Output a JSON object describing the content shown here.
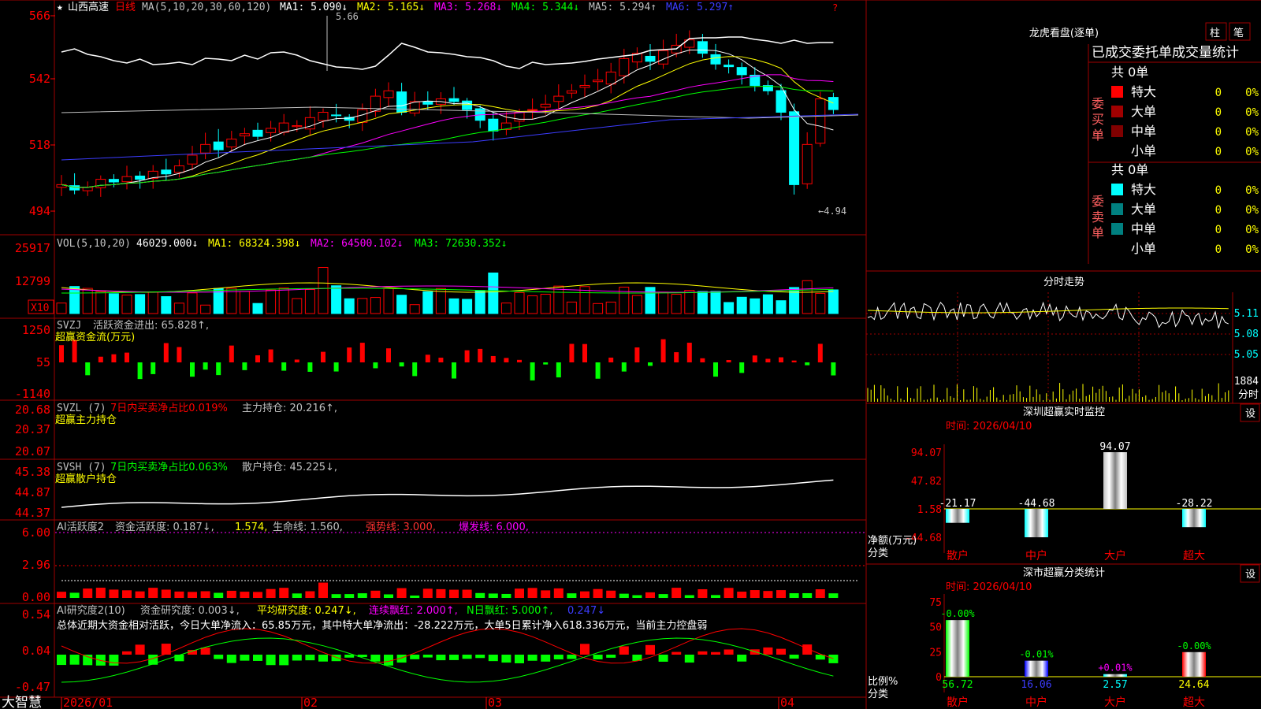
{
  "stock": {
    "star": "★",
    "name": "山西高速",
    "period": "日线"
  },
  "price_panel": {
    "ma_label": "MA(5,10,20,30,60,120)",
    "ma": [
      {
        "text": "MA1: 5.090↓",
        "color": "#ffffff"
      },
      {
        "text": "MA2: 5.165↓",
        "color": "#ffff00"
      },
      {
        "text": "MA3: 5.268↓",
        "color": "#ff00ff"
      },
      {
        "text": "MA4: 5.344↓",
        "color": "#00ff00"
      },
      {
        "text": "MA5: 5.294↑",
        "color": "#c0c0c0"
      },
      {
        "text": "MA6: 5.297↑",
        "color": "#3c3cff"
      }
    ],
    "y_ticks": [
      "566",
      "542",
      "518",
      "494"
    ],
    "high_mark": "5.66",
    "low_mark": "←4.94",
    "corner_mark": "?"
  },
  "vol_panel": {
    "label": "VOL(5,10,20)",
    "value": "46029.000↓",
    "ma": [
      {
        "text": "MA1: 68324.398↓",
        "color": "#ffff00"
      },
      {
        "text": "MA2: 64500.102↓",
        "color": "#ff00ff"
      },
      {
        "text": "MA3: 72630.352↓",
        "color": "#00ff00"
      }
    ],
    "y_ticks": [
      "25917",
      "12799"
    ],
    "unit": "X10"
  },
  "svzj_panel": {
    "label": "SVZJ",
    "text": "活跃资金进出: 65.828↑,",
    "sub": "超赢资金流(万元)",
    "y_ticks": [
      "1250",
      "55",
      "-1140"
    ]
  },
  "svzl_panel": {
    "label": "SVZL (7)",
    "text1": "7日内买卖净占比0.019%",
    "text2": "主力持仓: 20.216↑,",
    "sub": "超赢主力持仓",
    "y_ticks": [
      "20.68",
      "20.37",
      "20.07"
    ]
  },
  "svsh_panel": {
    "label": "SVSH (7)",
    "text1": "7日内买卖净占比0.063%",
    "text2": "散户持仓: 45.225↓,",
    "sub": "超赢散户持仓",
    "y_ticks": [
      "45.38",
      "44.87",
      "44.37"
    ]
  },
  "ai_activity_panel": {
    "label": "AI活跃度2",
    "items": [
      {
        "text": "资金活跃度: 0.187↓,",
        "color": "#c0c0c0"
      },
      {
        "text": "1.574,",
        "color": "#ffff00"
      },
      {
        "text": "生命线: 1.560,",
        "color": "#c0c0c0"
      },
      {
        "text": "强势线: 3.000,",
        "color": "#ff3030"
      },
      {
        "text": "爆发线: 6.000,",
        "color": "#ff00ff"
      }
    ],
    "y_ticks": [
      "6.00",
      "2.96",
      "0.00"
    ]
  },
  "ai_research_panel": {
    "label": "AI研究度2(10)",
    "items": [
      {
        "text": "资金研究度: 0.003↓,",
        "color": "#c0c0c0"
      },
      {
        "text": "平均研究度: 0.247↓,",
        "color": "#ffff00"
      },
      {
        "text": "连续飘红: 2.000↑,",
        "color": "#ff00ff"
      },
      {
        "text": "N日飘红: 5.000↑,",
        "color": "#00ff00"
      },
      {
        "text": "0.247↓",
        "color": "#3c3cff"
      }
    ],
    "summary": "总体近期大资金相对活跃，今日大单净流入：65.85万元，其中特大单净流出：-28.222万元，大单5日累计净入618.336万元，当前主力控盘弱",
    "y_ticks": [
      "0.54",
      "0.04",
      "-0.47"
    ]
  },
  "x_axis": {
    "brand": "大智慧",
    "dates": [
      "2026/01",
      "02",
      "03",
      "04"
    ]
  },
  "dragon_tiger": {
    "title": "龙虎看盘(逐单)",
    "btn_col": "柱",
    "btn_order": "笔",
    "header": "已成交委托单成交量统计",
    "buy": {
      "side_label": [
        "委",
        "买",
        "单"
      ],
      "total": "共 0单",
      "rows": [
        {
          "label": "特大",
          "color": "#ff0000",
          "count": "0",
          "pct": "0%"
        },
        {
          "label": "大单",
          "color": "#a00000",
          "count": "0",
          "pct": "0%"
        },
        {
          "label": "中单",
          "color": "#800000",
          "count": "0",
          "pct": "0%"
        },
        {
          "label": "小单",
          "color": "",
          "count": "0",
          "pct": "0%"
        }
      ]
    },
    "sell": {
      "side_label": [
        "委",
        "卖",
        "单"
      ],
      "total": "共 0单",
      "rows": [
        {
          "label": "特大",
          "color": "#00ffff",
          "count": "0",
          "pct": "0%"
        },
        {
          "label": "大单",
          "color": "#008080",
          "count": "0",
          "pct": "0%"
        },
        {
          "label": "中单",
          "color": "#008080",
          "count": "0",
          "pct": "0%"
        },
        {
          "label": "小单",
          "color": "",
          "count": "0",
          "pct": "0%"
        }
      ]
    }
  },
  "intraday": {
    "title": "分时走势",
    "price_ticks": [
      "5.11",
      "5.08",
      "5.05"
    ],
    "vol_tick": "1884",
    "vol_label": "分时"
  },
  "sz_monitor": {
    "title": "深圳超赢实时监控",
    "settings": "设",
    "time": "时间: 2026/04/10",
    "y_ticks": [
      "94.07",
      "47.82",
      "1.58",
      "-44.68"
    ],
    "ylabel": "净额(万元)",
    "xlabel": "分类",
    "chart_data": {
      "type": "bar",
      "categories": [
        "散户",
        "中户",
        "大户",
        "超大"
      ],
      "values": [
        -21.17,
        -44.68,
        94.07,
        -28.22
      ],
      "value_labels": [
        "-21.17",
        "-44.68",
        "94.07",
        "-28.22"
      ],
      "ylim": [
        -44.68,
        94.07
      ]
    }
  },
  "sz_class": {
    "title": "深市超赢分类统计",
    "settings": "设",
    "time": "时间: 2026/04/10",
    "y_ticks": [
      "75",
      "50",
      "25",
      "0"
    ],
    "ylabel": "比例%",
    "xlabel": "分类",
    "chart_data": {
      "type": "bar",
      "categories": [
        "散户",
        "中户",
        "大户",
        "超大"
      ],
      "values": [
        56.72,
        16.06,
        2.57,
        24.64
      ],
      "value_labels": [
        "56.72",
        "16.06",
        "2.57",
        "24.64"
      ],
      "change_labels": [
        "-0.00%",
        "-0.01%",
        "+0.01%",
        "-0.00%"
      ],
      "ylim": [
        0,
        75
      ]
    }
  }
}
